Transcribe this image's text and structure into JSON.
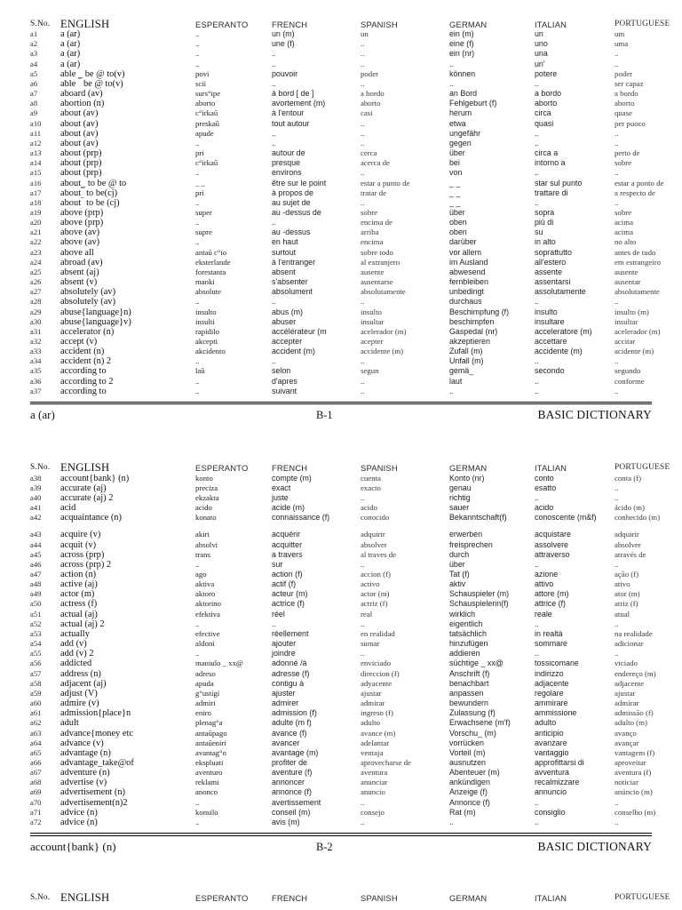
{
  "document": {
    "title": "BASIC DICTIONARY"
  },
  "columns": {
    "sno": "S.No.",
    "english": "ENGLISH",
    "esperanto": "ESPERANTO",
    "french": "FRENCH",
    "spanish": "SPANISH",
    "german": "GERMAN",
    "italian": "ITALIAN",
    "portuguese": "PORTUGUESE"
  },
  "pages": [
    {
      "id": "page-1",
      "footer": {
        "left": "a (ar)",
        "center": "B-1",
        "right": "BASIC DICTIONARY"
      },
      "rows": [
        [
          "a1",
          "a (ar)",
          "..",
          "un (m)",
          "un",
          "ein  (m)",
          "un",
          "um"
        ],
        [
          "a2",
          "a (ar)",
          "..",
          "une (f)",
          "..",
          "eine (f)",
          "uno",
          "uma"
        ],
        [
          "a3",
          "a (ar)",
          "..",
          "..",
          "..",
          "ein (nr)",
          "una",
          ".."
        ],
        [
          "a4",
          "a (ar)",
          "..",
          "..",
          "..",
          "..",
          "un'",
          ".."
        ],
        [
          "a5",
          "able _ be @ to(v)",
          "povi",
          "pouvoir",
          "poder",
          "können",
          "potere",
          "poder"
        ],
        [
          "a6",
          "able ‾ be @ to(v)",
          "scii",
          "..",
          "..",
          "..",
          "..",
          "ser capaz"
        ],
        [
          "a7",
          "aboard (av)",
          "surs°ipe",
          "à bord [ de ]",
          "a bordo",
          "an Bord",
          "a bordo",
          "a bordo"
        ],
        [
          "a8",
          "abortion (n)",
          "aborto",
          "avortement (m)",
          "aborto",
          "Fehlgeburt (f)",
          "aborto",
          "aborto"
        ],
        [
          "a9",
          "about (av)",
          "c°irkaŭ",
          "à l'entour",
          "casi",
          "herum",
          "circa",
          "quase"
        ],
        [
          "a10",
          "about (av)",
          "preskaŭ",
          "tout autour",
          "..",
          "etwa",
          "quasi",
          "per puoco"
        ],
        [
          "a11",
          "about (av)",
          "apude",
          "..",
          "..",
          "ungefähr",
          "..",
          ".."
        ],
        [
          "a12",
          "about (av)",
          "..",
          "..",
          "..",
          "gegen",
          "..",
          ".."
        ],
        [
          "a13",
          "about (prp)",
          "pri",
          "autour de",
          "cerca",
          "über",
          "circa  a",
          "perto de"
        ],
        [
          "a14",
          "about (prp)",
          "c°irkaŭ",
          "presque",
          "acerca de",
          "bei",
          "intorno a",
          "sobre"
        ],
        [
          "a15",
          "about (prp)",
          "..",
          "environs",
          "..",
          "von",
          "..",
          ".."
        ],
        [
          "a16",
          "about_ to be @ to",
          "_ _",
          "être sur le point",
          "estar a punto de",
          "_ _",
          "star sul punto",
          "estar a ponto de"
        ],
        [
          "a17",
          "about‾ to be(cj)",
          "pri",
          "à propos de",
          "tratar de",
          "_ _",
          "trattare di",
          "a respecto de"
        ],
        [
          "a18",
          "about‾ to be (cj)",
          "..",
          "au sujet de",
          "..",
          "_ _",
          "..",
          ".."
        ],
        [
          "a19",
          "above (prp)",
          "super",
          "au -dessus de",
          "sobre",
          "über",
          "sopra",
          "sobre"
        ],
        [
          "a20",
          "above (prp)",
          "..",
          "..",
          "encima de",
          "oben",
          "piú di",
          "acima"
        ],
        [
          "a21",
          "above (av)",
          "supre",
          "au -dessus",
          "arriba",
          "oben",
          "su",
          "acima"
        ],
        [
          "a22",
          "above (av)",
          "..",
          "en haut",
          "encima",
          "darüber",
          "in alto",
          "no alto"
        ],
        [
          "a23",
          "above all",
          "antaŭ c°io",
          "surtout",
          "sobre todo",
          "vor allem",
          "soprattutto",
          "antes de tudo"
        ],
        [
          "a24",
          "abroad (av)",
          "eksterlande",
          "à l'entranger",
          "al extranjero",
          "im Ausland",
          "all'estero",
          "em estrangeiro"
        ],
        [
          "a25",
          "absent (aj)",
          "forestanta",
          "absent",
          "ausente",
          "abwesend",
          "assente",
          "ausente"
        ],
        [
          "a26",
          "absent (v)",
          "manki",
          "s'absenter",
          "ausentarse",
          "fernbleiben",
          "assentarsi",
          "ausentar"
        ],
        [
          "a27",
          "absolutely (av)",
          "absolute",
          "absolument",
          "absolutamente",
          "unbedingt",
          "assolutamente",
          "absolutamente"
        ],
        [
          "a28",
          "absolutely (av)",
          "..",
          "..",
          "..",
          "durchaus",
          "..",
          ".."
        ],
        [
          "a29",
          "abuse{language}n)",
          "insulto",
          "abus (m)",
          "insulto",
          "Beschimpfung (f)",
          "insulto",
          "insulto (m)"
        ],
        [
          "a30",
          "abuse{language}v)",
          "insulti",
          "abuser",
          "insultar",
          "beschimpfen",
          "insultare",
          "insultar"
        ],
        [
          "a31",
          "accelerator (n)",
          "rapidilo",
          "accélérateur (m",
          "acelerador (m)",
          "Gaspedal (nr)",
          "acceleratore (m)",
          "acelerador (m)"
        ],
        [
          "a32",
          "accept (v)",
          "akcepti",
          "accepter",
          "acepter",
          "akzeptieren",
          "accettare",
          "accitar"
        ],
        [
          "a33",
          "accident (n)",
          "akcidento",
          "accident (m)",
          "accidente (m)",
          "Zufall (m)",
          "accidente (m)",
          "acidente (m)"
        ],
        [
          "a34",
          "accident (n)  2",
          "..",
          "..",
          "..",
          "Unfall (m)",
          "..",
          ".."
        ],
        [
          "a35",
          "according to",
          "laŭ",
          "selon",
          "segun",
          "gemä_",
          "secondo",
          "segundo"
        ],
        [
          "a36",
          "according to 2",
          "..",
          "d'apres",
          "..",
          "laut",
          "..",
          "conforme"
        ],
        [
          "a37",
          "according to",
          "..",
          "suivant",
          "..",
          "..",
          "..",
          ".."
        ]
      ],
      "spacer_after": []
    },
    {
      "id": "page-2",
      "footer": {
        "left": "account{bank} (n)",
        "center": "B-2",
        "right": "BASIC DICTIONARY"
      },
      "rows": [
        [
          "a38",
          "account{bank} (n)",
          "konto",
          "compte (m)",
          "cuenta",
          "Konto (nr)",
          "conto",
          "conta (f)"
        ],
        [
          "a39",
          "accurate (aj)",
          "preciza",
          "exact",
          "exacto",
          "genau",
          "esatto",
          ".."
        ],
        [
          "a40",
          "accurate (aj) 2",
          "ekzakta",
          "juste",
          "..",
          "richtig",
          "..",
          ".."
        ],
        [
          "a41",
          "acid",
          "acido",
          "acide (m)",
          "acido",
          "sauer",
          "acido",
          "ácido (m)"
        ],
        [
          "a42",
          "acquaintance (n)",
          "konato",
          "connaissance (f)",
          "conocido",
          "Bekanntschaft(f)",
          "conoscente (m&f)",
          "conhecido (m)"
        ],
        [
          "a43",
          "acquire (v)",
          "akiri",
          "acquérir",
          "adquirir",
          "erwerben",
          "acquistare",
          "adquirir"
        ],
        [
          "a44",
          "acquit (v)",
          "absolvi",
          "acquitter",
          "absolver",
          "freisprechen",
          "assolvere",
          "absolver"
        ],
        [
          "a45",
          "across (prp)",
          "trans",
          "a travers",
          "al traves de",
          "durch",
          "attraverso",
          "através de"
        ],
        [
          "a46",
          "across (prp) 2",
          "..",
          "sur",
          "..",
          "über",
          "..",
          ".."
        ],
        [
          "a47",
          "action (n)",
          "ago",
          "action (f)",
          "accion (f)",
          "Tat (f)",
          "azione",
          "ação (f)"
        ],
        [
          "a48",
          "active (aj)",
          "aktiva",
          "actif (f)",
          "activo",
          "aktiv",
          "attivo",
          "ativo"
        ],
        [
          "a49",
          "actor (m)",
          "aktoro",
          "acteur (m)",
          "actor (m)",
          "Schauspieler (m)",
          "attore (m)",
          "ator (m)"
        ],
        [
          "a50",
          "actress (f)",
          "aktorino",
          "actrice (f)",
          "actriz (f)",
          "Schauspielerin(f)",
          "attrice (f)",
          "atriz (f)"
        ],
        [
          "a51",
          "actual (aj)",
          "efektiva",
          "réel",
          "real",
          "wirklich",
          "reale",
          "atual"
        ],
        [
          "a52",
          "actual (aj) 2",
          "..",
          "..",
          "..",
          "eigentlich",
          "..",
          ".."
        ],
        [
          "a53",
          "actually",
          "efective",
          "réellement",
          "en realidad",
          "tatsächlich",
          "in realtà",
          "na realidade"
        ],
        [
          "a54",
          "add (v)",
          "aldoni",
          "ajouter",
          "sumar",
          "hinzufügen",
          "sommare",
          "adicionar"
        ],
        [
          "a55",
          "add (v) 2",
          "..",
          "joindre",
          "..",
          "addieren",
          "..",
          ".."
        ],
        [
          "a56",
          "addicted",
          "maniulo _ xx@",
          "adonné /à",
          "enviciado",
          "süchtige _ xx@",
          "tossicomane",
          "viciado"
        ],
        [
          "a57",
          "address (n)",
          "adreso",
          "adresse (f)",
          "direccion (f)",
          "Anschrift (f)",
          "indirizzo",
          "endereço (m)"
        ],
        [
          "a58",
          "adjacent (aj)",
          "apuda",
          "contigu à",
          "adyacente",
          "benachbart",
          "adjacente",
          "adjacente"
        ],
        [
          "a59",
          "adjust (V)",
          "g°ustigi",
          "ajuster",
          "ajustar",
          "anpassen",
          "regolare",
          "ajustar"
        ],
        [
          "a60",
          "admire (v)",
          "admiri",
          "admirer",
          "admirar",
          "bewundern",
          "ammirare",
          "admirar"
        ],
        [
          "a61",
          "admission{place}n",
          "eniro",
          "admission (f)",
          "ingreso (f)",
          "Zulassung (f)",
          "ammissione",
          "admissão (f)"
        ],
        [
          "a62",
          "adult",
          "plenag°a",
          "adulte (m f)",
          "adulto",
          "Erwachsene (m'f)",
          "adulto",
          "adulto (m)"
        ],
        [
          "a63",
          "advance{money etc",
          "antaŭpago",
          "avance (f)",
          "avance (m)",
          "Vorschu_ (m)",
          "anticipio",
          "avanço"
        ],
        [
          "a64",
          "advance (v)",
          "antaŭeniri",
          "avancer",
          "adelantar",
          "vorrücken",
          "avanzare",
          "avançar"
        ],
        [
          "a65",
          "advantage (n)",
          "avantag°o",
          "avantage (m)",
          "ventaja",
          "Vorteil (m)",
          "vantaggio",
          "vantagem (f)"
        ],
        [
          "a66",
          "advantage_take@of",
          "ekspluati",
          "profiter de",
          "aprovecharse de",
          "ausnutzen",
          "approfittarsi di",
          "aproveitar"
        ],
        [
          "a67",
          "adventure (n)",
          "aventuro",
          "aventure (f)",
          "aventura",
          "Abenteuer (m)",
          "avventura",
          "aventura (f)"
        ],
        [
          "a68",
          "advertise (v)",
          "reklami",
          "annoncer",
          "anunciar",
          "ankündigen",
          "recalmizzare",
          "noticiar"
        ],
        [
          "a69",
          "advertisement (n)",
          "anonco",
          "annonce (f)",
          "anuncio",
          "Anzeige (f)",
          "annuncio",
          "anúncio (m)"
        ],
        [
          "a70",
          "advertisement(n)2",
          "..",
          "avertissement",
          "..",
          "Annonce (f)",
          "..",
          ".."
        ],
        [
          "a71",
          "advice (n)",
          "konsilo",
          "conseil (m)",
          "consejo",
          "Rat (m)",
          "consiglio",
          "conselho (m)"
        ],
        [
          "a72",
          "advice (n)",
          "..",
          "avis (m)",
          "..",
          "..",
          "..",
          ".."
        ]
      ],
      "spacer_after": [
        4,
        41
      ]
    },
    {
      "id": "page-3",
      "footer": null,
      "rows": []
    }
  ]
}
